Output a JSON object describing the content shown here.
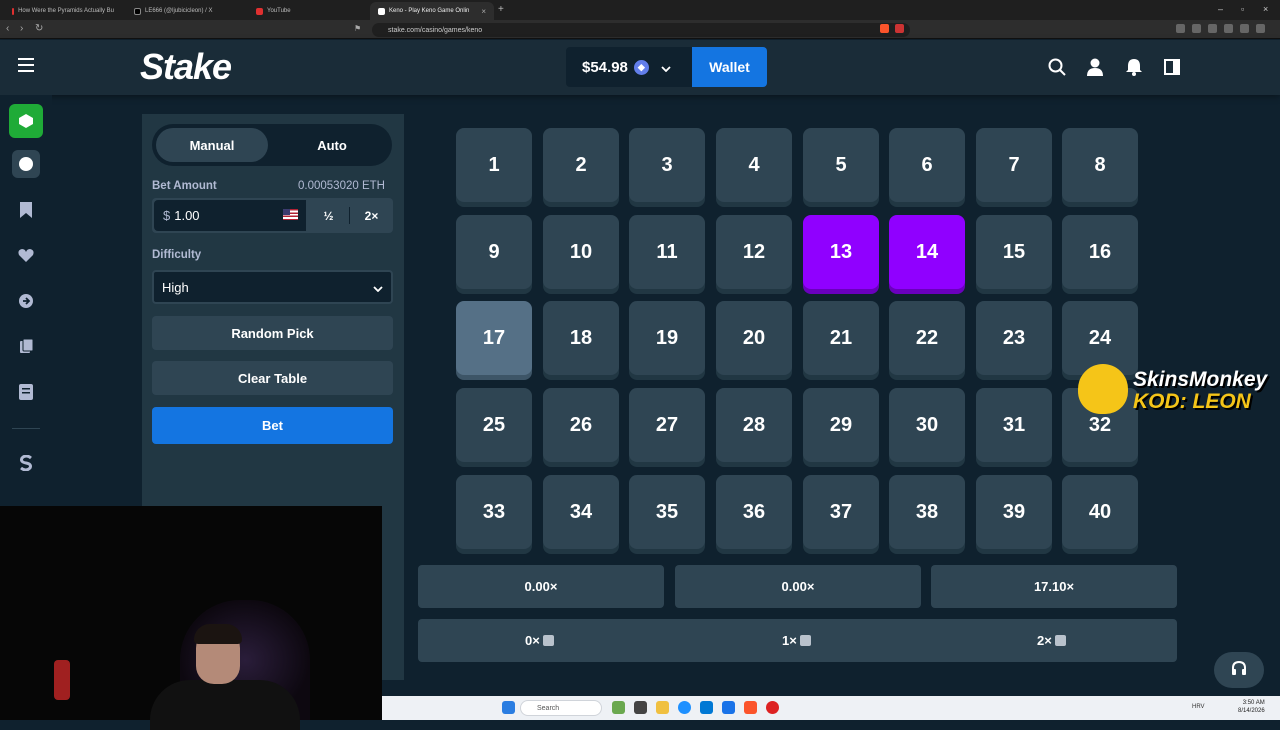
{
  "browser": {
    "tabs": [
      {
        "label": "How Were the Pyramids Actually Bu",
        "active": false
      },
      {
        "label": "LE666 (@ljubicicleon) / X",
        "active": false
      },
      {
        "label": "YouTube",
        "active": false
      },
      {
        "label": "Keno - Play Keno Game Onlin",
        "active": true
      }
    ],
    "url": "stake.com/casino/games/keno"
  },
  "header": {
    "logo": "Stake",
    "balance": "$54.98",
    "wallet_label": "Wallet"
  },
  "sidebar": {
    "mode_tabs": [
      "Manual",
      "Auto"
    ],
    "active_mode": "Manual",
    "bet_amount_label": "Bet Amount",
    "bet_amount_crypto": "0.00053020 ETH",
    "bet_currency_symbol": "$",
    "bet_value": "1.00",
    "half_label": "½",
    "double_label": "2×",
    "difficulty_label": "Difficulty",
    "difficulty_value": "High",
    "random_pick_label": "Random Pick",
    "clear_table_label": "Clear Table",
    "bet_label": "Bet"
  },
  "board": {
    "numbers": [
      "1",
      "2",
      "3",
      "4",
      "5",
      "6",
      "7",
      "8",
      "9",
      "10",
      "11",
      "12",
      "13",
      "14",
      "15",
      "16",
      "17",
      "18",
      "19",
      "20",
      "21",
      "22",
      "23",
      "24",
      "25",
      "26",
      "27",
      "28",
      "29",
      "30",
      "31",
      "32",
      "33",
      "34",
      "35",
      "36",
      "37",
      "38",
      "39",
      "40"
    ],
    "selected": [
      "13",
      "14"
    ],
    "hovered": "17"
  },
  "payouts": [
    "0.00×",
    "0.00×",
    "17.10×"
  ],
  "hits": [
    "0×",
    "1×",
    "2×"
  ],
  "sponsor": {
    "name": "SkinsMonkey",
    "code": "KOD: LEON"
  },
  "taskbar": {
    "search_placeholder": "Search",
    "time": "3:50 AM",
    "date": "8/14/2026",
    "lang": "HRV"
  },
  "colors": {
    "accent": "#1475e1",
    "selected_tile": "#9000ff",
    "tile": "#2f4553",
    "panel": "#213743",
    "bg": "#0f212e"
  }
}
